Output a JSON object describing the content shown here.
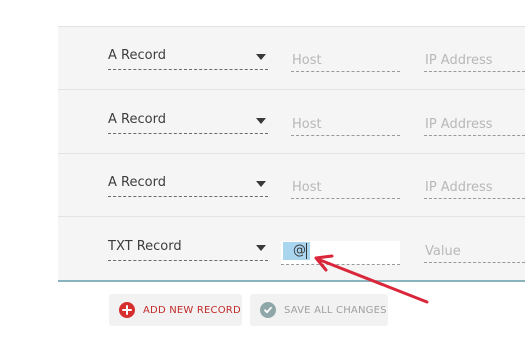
{
  "records": [
    {
      "type": "A Record",
      "host_placeholder": "Host",
      "value_placeholder": "IP Address"
    },
    {
      "type": "A Record",
      "host_placeholder": "Host",
      "value_placeholder": "IP Address"
    },
    {
      "type": "A Record",
      "host_placeholder": "Host",
      "value_placeholder": "IP Address"
    },
    {
      "type": "TXT Record",
      "host_value": "@",
      "value_placeholder": "Value"
    }
  ],
  "actions": {
    "add_label": "ADD NEW RECORD",
    "save_label": "SAVE ALL CHANGES"
  },
  "colors": {
    "add_accent": "#d62f2f",
    "save_accent": "#8fa7a9",
    "selection": "#a9d5ee",
    "annotation_arrow": "#d9263a",
    "panel_divider": "#8ab3bd"
  },
  "icons": {
    "add": "plus-circle-icon",
    "save": "check-circle-icon",
    "caret": "chevron-down-icon"
  }
}
